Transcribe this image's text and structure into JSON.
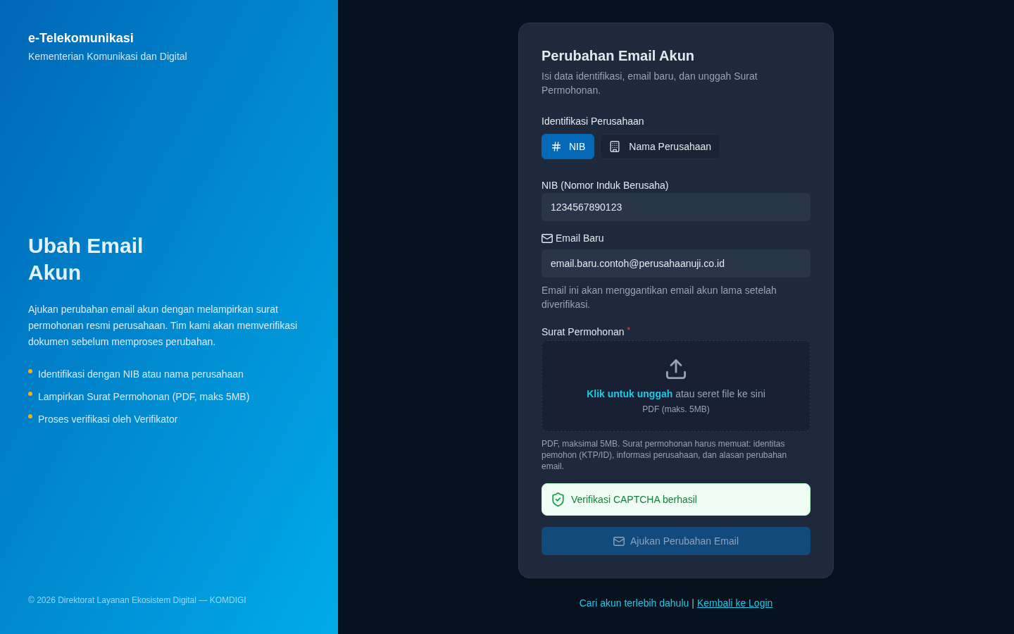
{
  "brand": {
    "title": "e-Telekomunikasi",
    "subtitle": "Kementerian Komunikasi dan Digital"
  },
  "hero": {
    "title": "Ubah Email Akun",
    "description": "Ajukan perubahan email akun dengan melampirkan surat permohonan resmi perusahaan. Tim kami akan memverifikasi dokumen sebelum memproses perubahan.",
    "bullets": [
      "Identifikasi dengan NIB atau nama perusahaan",
      "Lampirkan Surat Permohonan (PDF, maks 5MB)",
      "Proses verifikasi oleh Verifikator"
    ]
  },
  "footer": "© 2026 Direktorat Layanan Ekosistem Digital — KOMDIGI",
  "form": {
    "title": "Perubahan Email Akun",
    "subtitle": "Isi data identifikasi, email baru, dan unggah Surat Permohonan.",
    "identification": {
      "label": "Identifikasi Perusahaan",
      "tabs": [
        {
          "label": "NIB",
          "selected": true
        },
        {
          "label": "Nama Perusahaan",
          "selected": false
        }
      ]
    },
    "nib_field": {
      "label": "NIB (Nomor Induk Berusaha)",
      "value": "1234567890123"
    },
    "email_field": {
      "label": "Email Baru",
      "value": "email.baru.contoh@perusahaanuji.co.id",
      "hint": "Email ini akan menggantikan email akun lama setelah diverifikasi."
    },
    "upload": {
      "label": "Surat Permohonan",
      "required_mark": "*",
      "prompt": "**Klik untuk unggah** atau seret file ke sini",
      "formats": "PDF (maks. 5MB)",
      "help": "PDF, maksimal 5MB. Surat permohonan harus memuat: identitas pemohon (KTP/ID), informasi perusahaan, dan alasan perubahan email."
    },
    "captcha": {
      "text": "Verifikasi CAPTCHA berhasil",
      "verified": true
    },
    "submit": {
      "label": "Ajukan Perubahan Email",
      "disabled": true
    }
  },
  "links": {
    "find_account": "Cari akun terlebih dahulu",
    "separator": "|",
    "login": "Kembali ke Login"
  }
}
